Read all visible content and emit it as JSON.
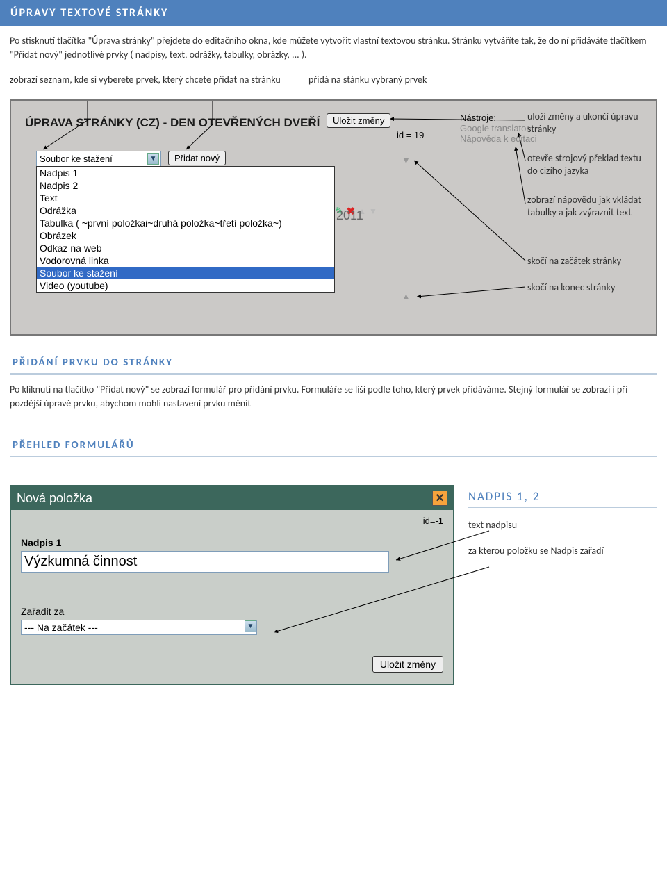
{
  "banner": "ÚPRAVY TEXTOVÉ STRÁNKY",
  "intro": "Po stisknutí tlačítka \"Úprava stránky\" přejdete do editačního okna, kde můžete vytvořit vlastní textovou stránku. Stránku vytváříte tak, že do ní přidáváte tlačítkem \"Přidat nový\" jednotlivé prvky ( nadpisy, text, odrážky, tabulky, obrázky, ... ).",
  "topLabels": {
    "left": "zobrazí seznam, kde si vyberete prvek, který chcete přidat na stránku",
    "right": "přidá na stánku vybraný prvek"
  },
  "editor": {
    "title": "ÚPRAVA STRÁNKY (CZ) - DEN OTEVŘENÝCH DVEŘÍ",
    "saveBtn": "Uložit změny",
    "idText": "id = 19",
    "tools": {
      "head": "Nástroje:",
      "translator": "Google translator",
      "help": "Nápověda k editaci"
    },
    "selectValue": "Soubor ke stažení",
    "addBtn": "Přidat nový",
    "options": [
      "Nadpis 1",
      "Nadpis 2",
      "Text",
      "Odrážka",
      "Tabulka ( ~první položkai~druhá položka~třetí položka~)",
      "Obrázek",
      "Odkaz na web",
      "Vodorovná linka",
      "Soubor ke stažení",
      "Video (youtube)"
    ],
    "highlightIndex": 8,
    "year": "2011"
  },
  "rightNotes": {
    "n1": "uloží změny a ukončí úpravu stránky",
    "n2": "otevře strojový překlad textu do cizího jazyka",
    "n3": "zobrazí nápovědu jak vkládat tabulky a jak zvýraznit text",
    "n4": "skočí na začátek stránky",
    "n5": "skočí na konec stránky"
  },
  "sec2": {
    "title": "PŘIDÁNÍ PRVKU DO STRÁNKY",
    "text": "Po kliknutí na tlačítko \"Přidat  nový\" se zobrazí formulář pro přidání prvku. Formuláře se liší podle toho, který prvek přidáváme. Stejný formulář se zobrazí i při pozdější úpravě prvku, abychom mohli nastavení prvku měnit"
  },
  "sec3": {
    "title": "PŘEHLED FORMULÁŘŮ"
  },
  "modal": {
    "title": "Nová položka",
    "id": "id=-1",
    "label1": "Nadpis 1",
    "value1": "Výzkumná činnost",
    "label2": "Zařadit za",
    "value2": "--- Na začátek ---",
    "saveBtn": "Uložit změny"
  },
  "sideAnnot": {
    "head": "NADPIS 1, 2",
    "l1": "text nadpisu",
    "l2": "za kterou položku se  Nadpis zařadí"
  }
}
